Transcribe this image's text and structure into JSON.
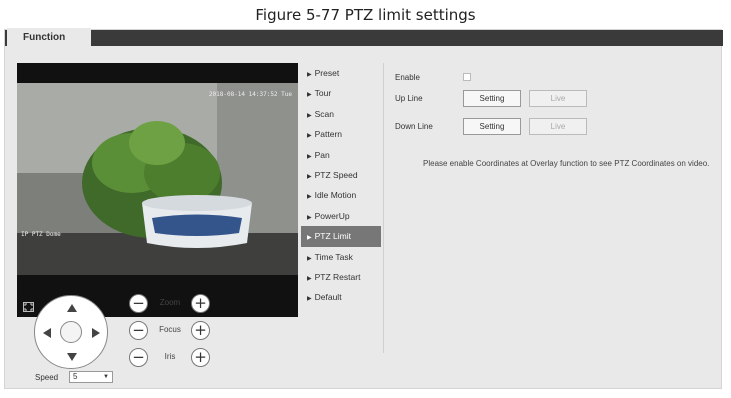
{
  "caption": "Figure 5-77 PTZ limit settings",
  "tab": {
    "label": "Function"
  },
  "video": {
    "osd_time": "2018-08-14 14:37:52 Tue",
    "osd_channel": "IP PTZ Dome"
  },
  "ptz": {
    "zoom_label": "Zoom",
    "focus_label": "Focus",
    "iris_label": "Iris",
    "minus": "−",
    "plus": "+",
    "speed_label": "Speed",
    "speed_value": "5"
  },
  "menu": {
    "items": [
      {
        "label": "Preset"
      },
      {
        "label": "Tour"
      },
      {
        "label": "Scan"
      },
      {
        "label": "Pattern"
      },
      {
        "label": "Pan"
      },
      {
        "label": "PTZ Speed"
      },
      {
        "label": "Idle Motion"
      },
      {
        "label": "PowerUp"
      },
      {
        "label": "PTZ Limit"
      },
      {
        "label": "Time Task"
      },
      {
        "label": "PTZ Restart"
      },
      {
        "label": "Default"
      }
    ],
    "active": "PTZ Limit"
  },
  "form": {
    "enable_label": "Enable",
    "enable_checked": false,
    "up_line_label": "Up Line",
    "down_line_label": "Down Line",
    "setting_label": "Setting",
    "live_label": "Live",
    "note": "Please enable Coordinates at Overlay function to see PTZ Coordinates on video."
  },
  "colors": {
    "topbar": "#3a3a3a",
    "panel_bg": "#e9e9e9",
    "active_menu_bg": "#777777"
  }
}
